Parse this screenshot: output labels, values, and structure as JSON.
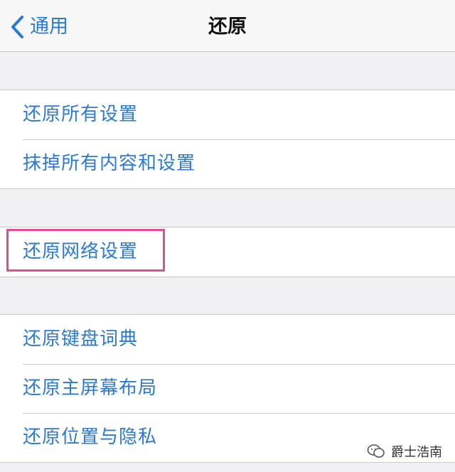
{
  "nav": {
    "back_label": "通用",
    "title": "还原"
  },
  "groups": [
    {
      "items": [
        {
          "label": "还原所有设置"
        },
        {
          "label": "抹掉所有内容和设置"
        }
      ]
    },
    {
      "items": [
        {
          "label": "还原网络设置",
          "highlighted": true
        }
      ]
    },
    {
      "items": [
        {
          "label": "还原键盘词典"
        },
        {
          "label": "还原主屏幕布局"
        },
        {
          "label": "还原位置与隐私"
        }
      ]
    }
  ],
  "watermark": {
    "text": "爵士浩南",
    "icon": "chat-bubble-icon"
  },
  "colors": {
    "accent": "#2a7ad6",
    "highlight": "#e34e8e",
    "background": "#efeff4"
  }
}
